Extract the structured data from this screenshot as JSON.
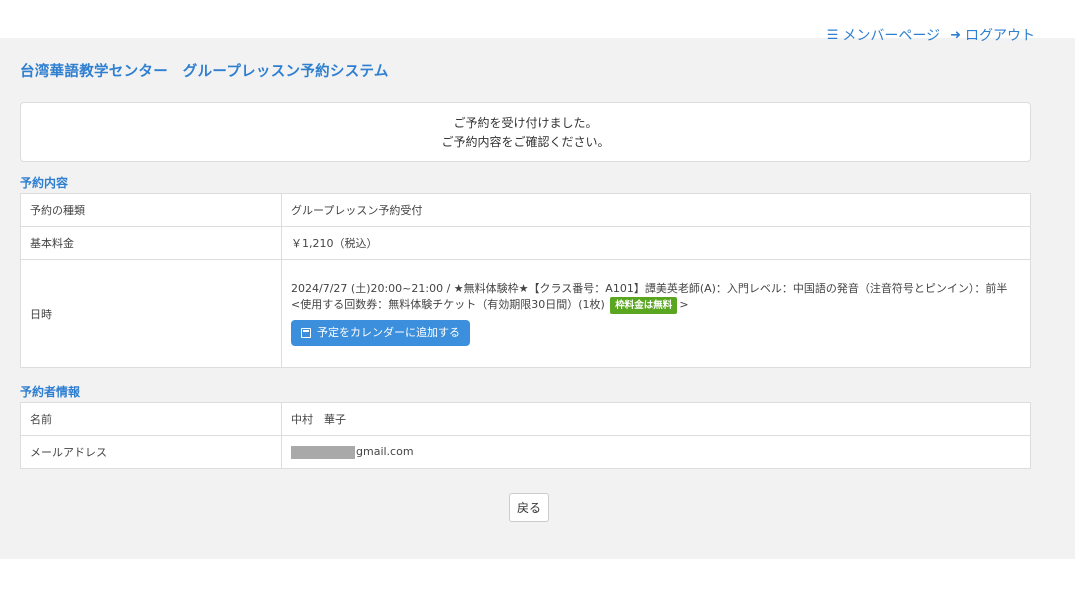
{
  "nav": {
    "member_page": "メンバーページ",
    "logout": "ログアウト"
  },
  "site_title": "台湾華語教学センター　グループレッスン予約システム",
  "notice": {
    "line1": "ご予約を受け付けました。",
    "line2": "ご予約内容をご確認ください。"
  },
  "reservation": {
    "section_title": "予約内容",
    "type_label": "予約の種類",
    "type_value": "グループレッスン予約受付",
    "fee_label": "基本料金",
    "fee_value": "￥1,210（税込）",
    "datetime_label": "日時",
    "datetime_value": "2024/7/27 (土)20:00~21:00 / ★無料体験枠★【クラス番号：A101】譚美英老師(A)：入門レベル：中国語の発音（注音符号とピンイン）：前半",
    "ticket_prefix": "<使用する回数券：無料体験チケット（有効期限30日間）(1枚)",
    "ticket_badge": "枠料金は無料",
    "ticket_suffix": ">",
    "calendar_button": "予定をカレンダーに追加する"
  },
  "booker": {
    "section_title": "予約者情報",
    "name_label": "名前",
    "name_value": "中村　華子",
    "email_label": "メールアドレス",
    "email_value": "gmail.com"
  },
  "back_button": "戻る",
  "colors": {
    "accent": "#2f7fd1",
    "button_blue": "#3b8fdc",
    "badge_green": "#5aa620",
    "panel_bg": "#f2f2f2"
  }
}
